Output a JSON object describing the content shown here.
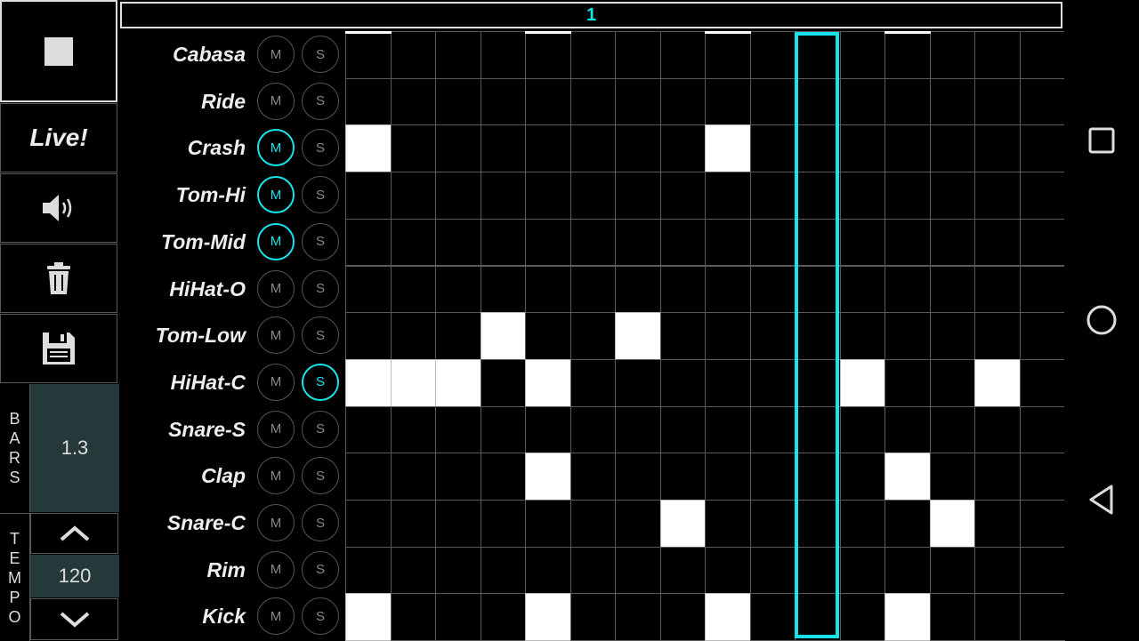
{
  "sidebar": {
    "live_label": "Live!",
    "bars_label": [
      "B",
      "A",
      "R",
      "S"
    ],
    "bars_value": "1.3",
    "tempo_label": [
      "T",
      "E",
      "M",
      "P",
      "O"
    ],
    "tempo_value": "120"
  },
  "header": {
    "bar_number": "1"
  },
  "colors": {
    "accent": "#19e3ea",
    "on": "#ffffff",
    "grid": "#5a5a5a",
    "panel": "#26393a"
  },
  "icons": {
    "stop": "stop-icon",
    "volume": "speaker-icon",
    "trash": "trash-icon",
    "save": "floppy-icon",
    "up": "chevron-up-icon",
    "down": "chevron-down-icon",
    "nav_recent": "square-icon",
    "nav_home": "circle-icon",
    "nav_back": "triangle-back-icon"
  },
  "mute_label": "M",
  "solo_label": "S",
  "playhead_step": 10,
  "tracks": [
    {
      "name": "Cabasa",
      "mute": false,
      "solo": false,
      "steps": [
        0,
        0,
        0,
        0,
        0,
        0,
        0,
        0,
        0,
        0,
        0,
        0,
        0,
        0,
        0,
        0
      ]
    },
    {
      "name": "Ride",
      "mute": false,
      "solo": false,
      "steps": [
        0,
        0,
        0,
        0,
        0,
        0,
        0,
        0,
        0,
        0,
        0,
        0,
        0,
        0,
        0,
        0
      ]
    },
    {
      "name": "Crash",
      "mute": true,
      "solo": false,
      "steps": [
        1,
        0,
        0,
        0,
        0,
        0,
        0,
        0,
        1,
        0,
        0,
        0,
        0,
        0,
        0,
        0
      ]
    },
    {
      "name": "Tom-Hi",
      "mute": true,
      "solo": false,
      "steps": [
        0,
        0,
        0,
        0,
        0,
        0,
        0,
        0,
        0,
        0,
        0,
        0,
        0,
        0,
        0,
        0
      ]
    },
    {
      "name": "Tom-Mid",
      "mute": true,
      "solo": false,
      "steps": [
        0,
        0,
        0,
        0,
        0,
        0,
        0,
        0,
        0,
        0,
        0,
        0,
        0,
        0,
        0,
        0
      ]
    },
    {
      "name": "HiHat-O",
      "mute": false,
      "solo": false,
      "steps": [
        0,
        0,
        0,
        0,
        0,
        0,
        0,
        0,
        0,
        0,
        0,
        0,
        0,
        0,
        0,
        0
      ]
    },
    {
      "name": "Tom-Low",
      "mute": false,
      "solo": false,
      "steps": [
        0,
        0,
        0,
        1,
        0,
        0,
        1,
        0,
        0,
        0,
        0,
        0,
        0,
        0,
        0,
        0
      ]
    },
    {
      "name": "HiHat-C",
      "mute": false,
      "solo": true,
      "steps": [
        1,
        1,
        1,
        0,
        1,
        0,
        0,
        0,
        0,
        0,
        0,
        1,
        0,
        0,
        1,
        0
      ]
    },
    {
      "name": "Snare-S",
      "mute": false,
      "solo": false,
      "steps": [
        0,
        0,
        0,
        0,
        0,
        0,
        0,
        0,
        0,
        0,
        0,
        0,
        0,
        0,
        0,
        0
      ]
    },
    {
      "name": "Clap",
      "mute": false,
      "solo": false,
      "steps": [
        0,
        0,
        0,
        0,
        1,
        0,
        0,
        0,
        0,
        0,
        0,
        0,
        1,
        0,
        0,
        0
      ]
    },
    {
      "name": "Snare-C",
      "mute": false,
      "solo": false,
      "steps": [
        0,
        0,
        0,
        0,
        0,
        0,
        0,
        1,
        0,
        0,
        0,
        0,
        0,
        1,
        0,
        0
      ]
    },
    {
      "name": "Rim",
      "mute": false,
      "solo": false,
      "steps": [
        0,
        0,
        0,
        0,
        0,
        0,
        0,
        0,
        0,
        0,
        0,
        0,
        0,
        0,
        0,
        0
      ]
    },
    {
      "name": "Kick",
      "mute": false,
      "solo": false,
      "steps": [
        1,
        0,
        0,
        0,
        1,
        0,
        0,
        0,
        1,
        0,
        0,
        0,
        1,
        0,
        0,
        0
      ]
    }
  ]
}
